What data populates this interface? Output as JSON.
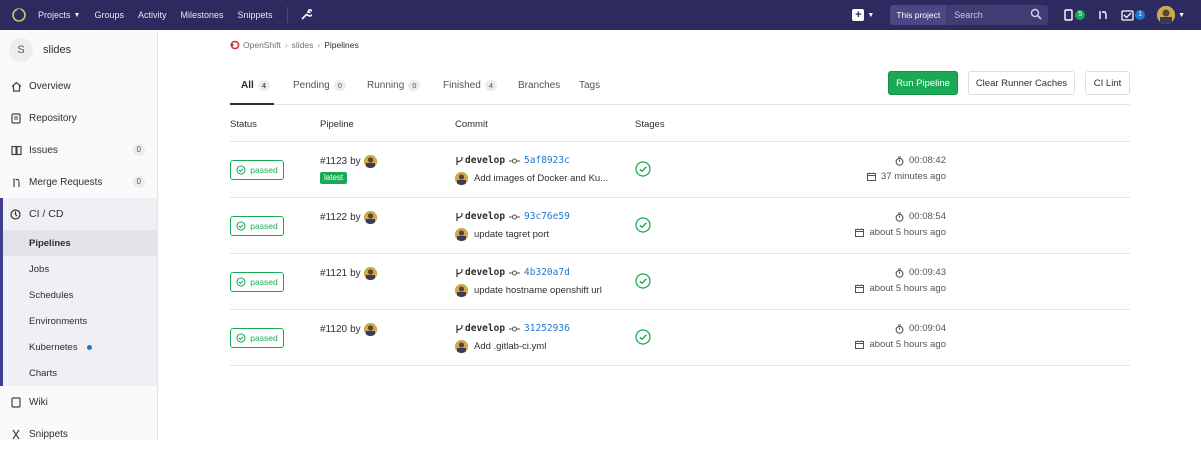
{
  "nav": {
    "items": [
      {
        "label": "Projects",
        "has_dropdown": true
      },
      {
        "label": "Groups",
        "has_dropdown": false
      },
      {
        "label": "Activity",
        "has_dropdown": false
      },
      {
        "label": "Milestones",
        "has_dropdown": false
      },
      {
        "label": "Snippets",
        "has_dropdown": false
      }
    ],
    "search_scope": "This project",
    "search_placeholder": "Search",
    "merge_request_count": "5",
    "todo_count": "1",
    "colors": {
      "bar": "#2c2a5e",
      "green": "#1aaa55",
      "blue": "#1f78d1"
    }
  },
  "sidebar": {
    "project_initial": "S",
    "project_name": "slides",
    "items": [
      {
        "label": "Overview",
        "icon": "home-icon"
      },
      {
        "label": "Repository",
        "icon": "book-icon"
      },
      {
        "label": "Issues",
        "icon": "issues-icon",
        "count": "0"
      },
      {
        "label": "Merge Requests",
        "icon": "merge-request-icon",
        "count": "0"
      }
    ],
    "cicd": {
      "label": "CI / CD",
      "icon": "rocket-icon",
      "sub": [
        {
          "label": "Pipelines",
          "active": true
        },
        {
          "label": "Jobs"
        },
        {
          "label": "Schedules"
        },
        {
          "label": "Environments"
        },
        {
          "label": "Kubernetes",
          "dot": true
        },
        {
          "label": "Charts"
        }
      ]
    },
    "after": [
      {
        "label": "Wiki",
        "icon": "book-icon"
      },
      {
        "label": "Snippets",
        "icon": "snippet-icon"
      }
    ]
  },
  "breadcrumb": {
    "group": "OpenShift",
    "project": "slides",
    "current": "Pipelines"
  },
  "tabs": [
    {
      "label": "All",
      "count": "4",
      "active": true
    },
    {
      "label": "Pending",
      "count": "0"
    },
    {
      "label": "Running",
      "count": "0"
    },
    {
      "label": "Finished",
      "count": "4"
    },
    {
      "label": "Branches"
    },
    {
      "label": "Tags"
    }
  ],
  "buttons": {
    "run": "Run Pipeline",
    "clear": "Clear Runner Caches",
    "lint": "CI Lint"
  },
  "table": {
    "headers": [
      "Status",
      "Pipeline",
      "Commit",
      "Stages"
    ],
    "rows": [
      {
        "status": "passed",
        "pipeline": "#1123",
        "by": "by",
        "latest": "latest",
        "branch": "develop",
        "sha": "5af8923c",
        "message": "Add images of Docker and Ku...",
        "duration": "00:08:42",
        "ago": "37 minutes ago"
      },
      {
        "status": "passed",
        "pipeline": "#1122",
        "by": "by",
        "branch": "develop",
        "sha": "93c76e59",
        "message": "update tagret port",
        "duration": "00:08:54",
        "ago": "about 5 hours ago"
      },
      {
        "status": "passed",
        "pipeline": "#1121",
        "by": "by",
        "branch": "develop",
        "sha": "4b320a7d",
        "message": "update hostname openshift url",
        "duration": "00:09:43",
        "ago": "about 5 hours ago"
      },
      {
        "status": "passed",
        "pipeline": "#1120",
        "by": "by",
        "branch": "develop",
        "sha": "31252936",
        "message": "Add .gitlab-ci.yml",
        "duration": "00:09:04",
        "ago": "about 5 hours ago"
      }
    ]
  }
}
